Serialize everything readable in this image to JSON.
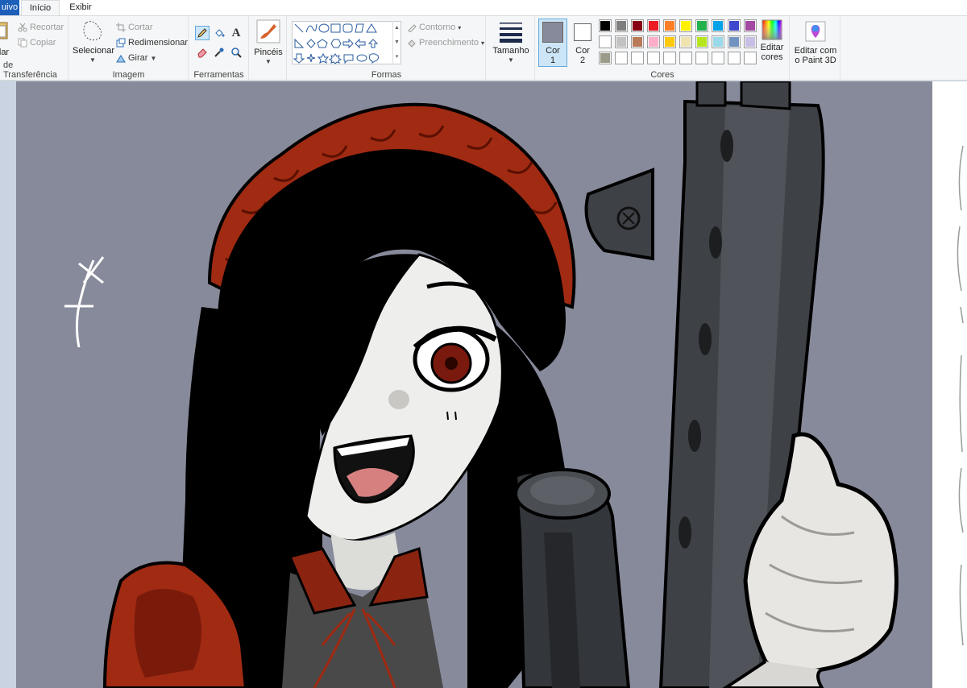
{
  "tabs": {
    "file": "uivo",
    "home": "Início",
    "view": "Exibir"
  },
  "clipboard": {
    "paste": "lar",
    "cut": "Recortar",
    "copy": "Copiar",
    "label": "de Transferência"
  },
  "image": {
    "select": "Selecionar",
    "crop": "Cortar",
    "resize": "Redimensionar",
    "rotate": "Girar",
    "label": "Imagem"
  },
  "tools": {
    "label": "Ferramentas",
    "text_glyph": "A"
  },
  "brushes": {
    "label": "Pincéis"
  },
  "shapes": {
    "outline": "Contorno",
    "fill": "Preenchimento",
    "label": "Formas"
  },
  "size": {
    "label": "Tamanho"
  },
  "colors": {
    "color1_label": "Cor",
    "color1_num": "1",
    "color2_label": "Cor",
    "color2_num": "2",
    "edit_colors_1": "Editar",
    "edit_colors_2": "cores",
    "label": "Cores",
    "color1": "#878a9a",
    "color2": "#ffffff",
    "palette_row1": [
      "#000000",
      "#7f7f7f",
      "#880015",
      "#ed1c24",
      "#ff7f27",
      "#fff200",
      "#22b14c",
      "#00a2e8",
      "#3f48cc",
      "#a349a4"
    ],
    "palette_row2": [
      "#ffffff",
      "#c3c3c3",
      "#b97a57",
      "#ffaec9",
      "#ffc90e",
      "#efe4b0",
      "#b5e61d",
      "#99d9ea",
      "#7092be",
      "#c8bfe7"
    ],
    "palette_row3": [
      "#9a9b88",
      "#ffffff",
      "#ffffff",
      "#ffffff",
      "#ffffff",
      "#ffffff",
      "#ffffff",
      "#ffffff",
      "#ffffff",
      "#ffffff"
    ]
  },
  "paint3d": {
    "line1": "Editar com",
    "line2": "o Paint 3D"
  },
  "canvas": {
    "background": "#878a9a"
  }
}
